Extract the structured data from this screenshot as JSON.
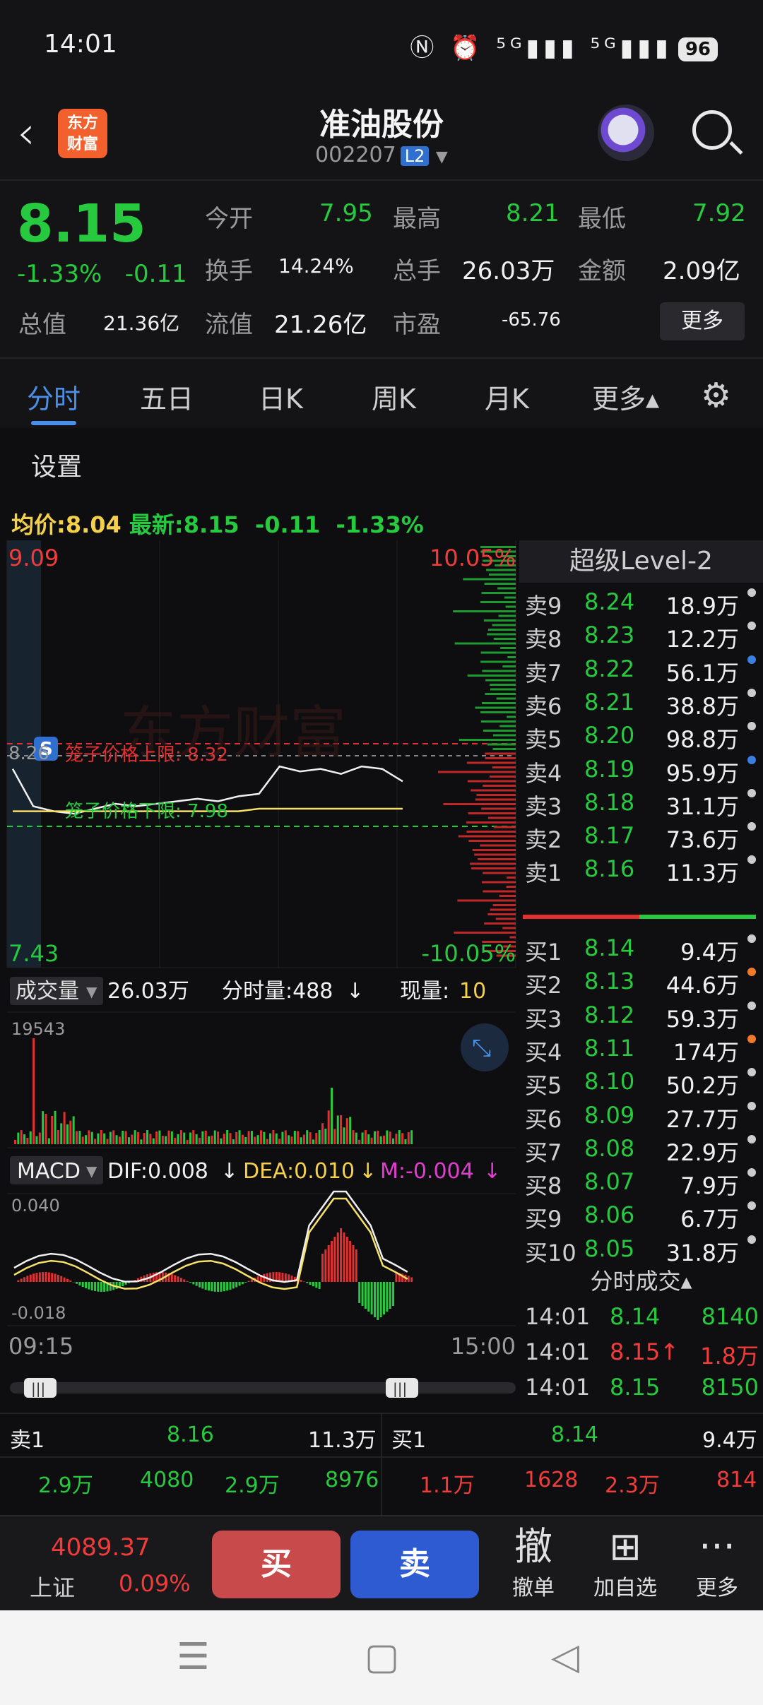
{
  "status_bar": {
    "time": "14:01",
    "icons": "Ⓝ ⏰ ⁵ᴳ▮▮▮ ⁵ᴳ▮▮▮",
    "battery": "96"
  },
  "header": {
    "logo_text": "东方\n财富",
    "title": "准油股份",
    "code": "002207",
    "level_badge": "L2"
  },
  "quote": {
    "price": "8.15",
    "change_pct": "-1.33%",
    "change": "-0.11",
    "open_label": "今开",
    "open": "7.95",
    "high_label": "最高",
    "high": "8.21",
    "low_label": "最低",
    "low": "7.92",
    "turnover_label": "换手",
    "turnover": "14.24%",
    "volume_label": "总手",
    "volume": "26.03万",
    "amount_label": "金额",
    "amount": "2.09亿",
    "total_cap_label": "总值",
    "total_cap": "21.36亿",
    "float_cap_label": "流值",
    "float_cap": "21.26亿",
    "pe_label": "市盈",
    "pe": "-65.76",
    "more_label": "更多"
  },
  "tabs": [
    {
      "label": "分时"
    },
    {
      "label": "五日"
    },
    {
      "label": "日K"
    },
    {
      "label": "周K"
    },
    {
      "label": "月K"
    },
    {
      "label": "更多▴"
    }
  ],
  "settings_label": "设置",
  "avg_line": {
    "avg_label": "均价:",
    "avg": "8.04",
    "latest_label": "最新:",
    "latest": "8.15",
    "change": "-0.11",
    "change_pct": "-1.33%"
  },
  "chart": {
    "y_max": "9.09",
    "y_min": "7.43",
    "pct_max": "10.05%",
    "pct_min": "-10.05%",
    "prev_close_label": "8.26",
    "upper_limit_label": "笼子价格上限: 8.32",
    "lower_limit_label": "笼子价格下限: 7.98",
    "watermark": "东方财富",
    "volume_bar": {
      "label": "成交量",
      "total": "26.03万",
      "tick_label": "分时量:488",
      "now_label": "现量:",
      "now": "10"
    },
    "volume_max": "19543",
    "macd_bar": {
      "label": "MACD",
      "dif": "DIF:0.008",
      "dea": "DEA:0.010",
      "m": "M:-0.004"
    },
    "macd_top": "0.040",
    "macd_bottom": "-0.018",
    "time_start": "09:15",
    "time_end": "15:00"
  },
  "chart_data": {
    "type": "line",
    "title": "",
    "ylim": [
      7.43,
      9.09
    ],
    "series": [
      {
        "name": "最新",
        "values": [
          8.2,
          8.05,
          8.03,
          8.02,
          8.04,
          8.06,
          8.05,
          8.06,
          8.07,
          8.08,
          8.07,
          8.09,
          8.1,
          8.21,
          8.19,
          8.2,
          8.18,
          8.21,
          8.2,
          8.15
        ]
      },
      {
        "name": "均价",
        "values": [
          8.03,
          8.03,
          8.03,
          8.03,
          8.03,
          8.03,
          8.03,
          8.03,
          8.03,
          8.03,
          8.03,
          8.03,
          8.04,
          8.04,
          8.04,
          8.04,
          8.04,
          8.04,
          8.04,
          8.04
        ]
      }
    ]
  },
  "order_book": {
    "title": "超级Level-2",
    "sells": [
      {
        "label": "卖9",
        "price": "8.24",
        "vol": "18.9万",
        "dot": "#cccccc"
      },
      {
        "label": "卖8",
        "price": "8.23",
        "vol": "12.2万",
        "dot": "#cccccc"
      },
      {
        "label": "卖7",
        "price": "8.22",
        "vol": "56.1万",
        "dot": "#3a7fe0"
      },
      {
        "label": "卖6",
        "price": "8.21",
        "vol": "38.8万",
        "dot": "#cccccc"
      },
      {
        "label": "卖5",
        "price": "8.20",
        "vol": "98.8万",
        "dot": "#cccccc"
      },
      {
        "label": "卖4",
        "price": "8.19",
        "vol": "95.9万",
        "dot": "#3a7fe0"
      },
      {
        "label": "卖3",
        "price": "8.18",
        "vol": "31.1万",
        "dot": "#cccccc"
      },
      {
        "label": "卖2",
        "price": "8.17",
        "vol": "73.6万",
        "dot": "#cccccc"
      },
      {
        "label": "卖1",
        "price": "8.16",
        "vol": "11.3万",
        "dot": "#cccccc"
      }
    ],
    "buys": [
      {
        "label": "买1",
        "price": "8.14",
        "vol": "9.4万",
        "dot": "#cccccc"
      },
      {
        "label": "买2",
        "price": "8.13",
        "vol": "44.6万",
        "dot": "#f07a2a"
      },
      {
        "label": "买3",
        "price": "8.12",
        "vol": "59.3万",
        "dot": "#cccccc"
      },
      {
        "label": "买4",
        "price": "8.11",
        "vol": "174万",
        "dot": "#f07a2a"
      },
      {
        "label": "买5",
        "price": "8.10",
        "vol": "50.2万",
        "dot": "#cccccc"
      },
      {
        "label": "买6",
        "price": "8.09",
        "vol": "27.7万",
        "dot": "#cccccc"
      },
      {
        "label": "买7",
        "price": "8.08",
        "vol": "22.9万",
        "dot": "#cccccc"
      },
      {
        "label": "买8",
        "price": "8.07",
        "vol": "7.9万",
        "dot": "#cccccc"
      },
      {
        "label": "买9",
        "price": "8.06",
        "vol": "6.7万",
        "dot": "#cccccc"
      },
      {
        "label": "买10",
        "price": "8.05",
        "vol": "31.8万",
        "dot": "#cccccc"
      }
    ],
    "ticks_title": "分时成交▴",
    "ticks": [
      {
        "time": "14:01",
        "price": "8.14",
        "vol": "8140",
        "price_color": "green",
        "vol_color": "green"
      },
      {
        "time": "14:01",
        "price": "8.15↑",
        "vol": "1.8万",
        "price_color": "red",
        "vol_color": "red"
      },
      {
        "time": "14:01",
        "price": "8.15",
        "vol": "8150",
        "price_color": "green",
        "vol_color": "green"
      }
    ]
  },
  "bottom_table": {
    "sell_label": "卖1",
    "sell_price": "8.16",
    "sell_vol": "11.3万",
    "buy_label": "买1",
    "buy_price": "8.14",
    "buy_vol": "9.4万",
    "left_row": [
      "2.9万",
      "4080",
      "2.9万",
      "8976"
    ],
    "right_row": [
      "1.1万",
      "1628",
      "2.3万",
      "814"
    ]
  },
  "action_bar": {
    "index_value": "4089.37",
    "index_name": "上证",
    "index_pct": "0.09%",
    "buy": "买",
    "sell": "卖",
    "cancel_icon": "撤",
    "cancel_label": "撤单",
    "add_label": "加自选",
    "more_label": "更多"
  }
}
